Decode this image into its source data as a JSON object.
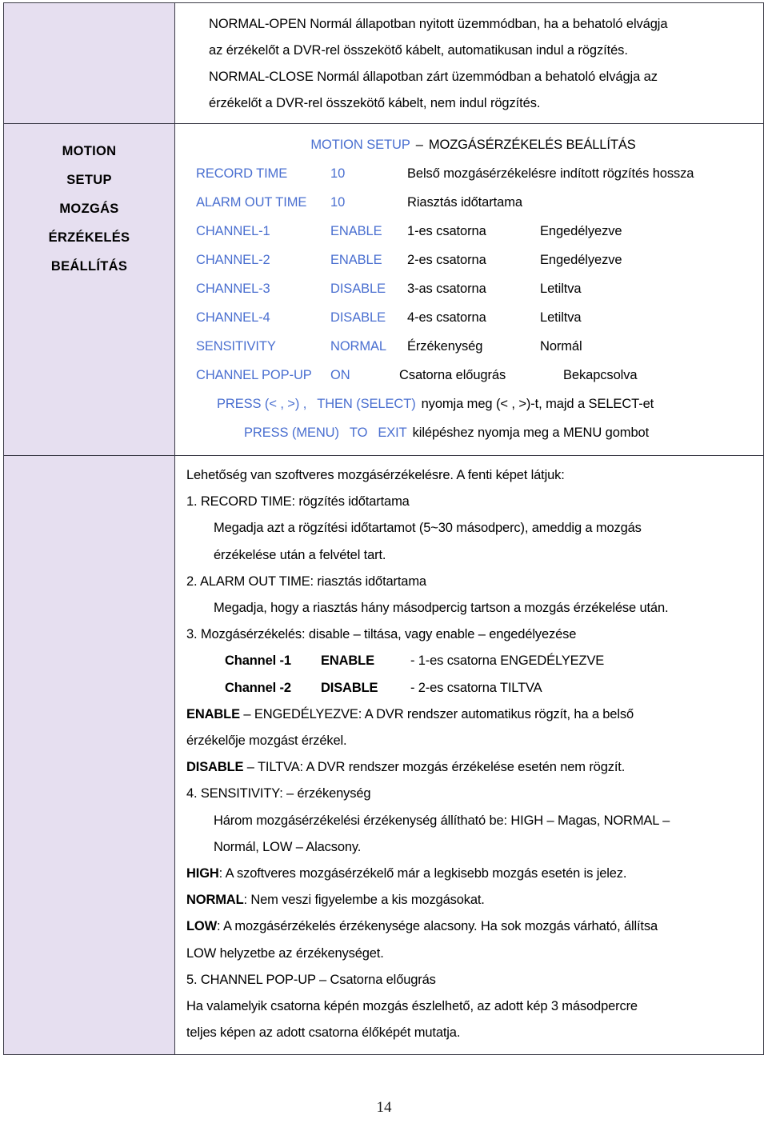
{
  "document": {
    "page_number": "14",
    "colors": {
      "sidebar_background": "#e6dff0",
      "menu_blue": "#4a6fd0",
      "border": "#3a3a46",
      "text": "#000000"
    }
  },
  "intro": {
    "line1": "NORMAL-OPEN Normál állapotban nyitott üzemmódban, ha a behatoló elvágja",
    "line2": "az érzékelőt a DVR-rel összekötő kábelt, automatikusan indul a rögzítés.",
    "line3": "NORMAL-CLOSE Normál állapotban zárt üzemmódban a behatoló elvágja az",
    "line4": "érzékelőt a DVR-rel összekötő kábelt, nem indul rögzítés."
  },
  "sidebar": {
    "items": [
      {
        "label": "MOTION"
      },
      {
        "label": "SETUP"
      },
      {
        "label": "MOZGÁS"
      },
      {
        "label": "ÉRZÉKELÉS"
      },
      {
        "label": "BEÁLLÍTÁS"
      }
    ]
  },
  "menu_screen": {
    "title_en": "MOTION SETUP",
    "title_sep": "–",
    "title_hu": "MOZGÁSÉRZÉKELÉS BEÁLLÍTÁS",
    "rows": [
      {
        "key": "RECORD TIME",
        "value": "10",
        "desc": "Belső mozgásérzékelésre indított rögzítés hossza",
        "state": ""
      },
      {
        "key": "ALARM OUT TIME",
        "value": "10",
        "desc": "Riasztás időtartama",
        "state": ""
      },
      {
        "key": "CHANNEL-1",
        "value": "ENABLE",
        "desc": "1-es csatorna",
        "state": "Engedélyezve"
      },
      {
        "key": "CHANNEL-2",
        "value": "ENABLE",
        "desc": "2-es csatorna",
        "state": "Engedélyezve"
      },
      {
        "key": "CHANNEL-3",
        "value": "DISABLE",
        "desc": "3-as csatorna",
        "state": "Letiltva"
      },
      {
        "key": "CHANNEL-4",
        "value": "DISABLE",
        "desc": "4-es csatorna",
        "state": "Letiltva"
      },
      {
        "key": "SENSITIVITY",
        "value": "NORMAL",
        "desc": "Érzékenység",
        "state": "Normál"
      },
      {
        "key": "CHANNEL POP-UP",
        "value": "ON",
        "desc": "Csatorna előugrás",
        "state": "Bekapcsolva"
      }
    ],
    "footer": {
      "press_keys_en_a": "PRESS (< , >) ,",
      "press_keys_en_b": "THEN (SELECT)",
      "press_keys_hu": "nyomja meg (< , >)-t, majd a SELECT-et",
      "press_menu_en_a": "PRESS (MENU)",
      "press_menu_en_b": "TO",
      "press_menu_en_c": "EXIT",
      "press_menu_hu": "kilépéshez nyomja meg a MENU gombot"
    }
  },
  "prose": {
    "intro_line": "Lehetőség van szoftveres mozgásérzékelésre. A fenti képet látjuk:",
    "item1_head": "1. RECORD TIME: rögzítés időtartama",
    "item1_body_a": "Megadja azt a rögzítési időtartamot (5~30 másodperc), ameddig a mozgás",
    "item1_body_b": "érzékelése után a felvétel tart.",
    "item2_head": "2. ALARM OUT TIME: riasztás időtartama",
    "item2_body": "Megadja, hogy a riasztás hány másodpercig tartson a mozgás érzékelése után.",
    "item3_head": "3. Mozgásérzékelés: disable – tiltása, vagy enable – engedélyezése",
    "channel1_name": "Channel -1",
    "channel1_val": "ENABLE",
    "channel1_desc": "- 1-es csatorna ENGEDÉLYEZVE",
    "channel2_name": "Channel -2",
    "channel2_val": "DISABLE",
    "channel2_desc": "- 2-es csatorna TILTVA",
    "enable_term": "ENABLE",
    "enable_text_a": " – ENGEDÉLYEZVE: A DVR rendszer automatikus rögzít, ha a belső",
    "enable_text_b": "érzékelője mozgást érzékel.",
    "disable_term": "DISABLE",
    "disable_text": " – TILTVA: A DVR rendszer mozgás érzékelése esetén nem rögzít.",
    "item4_head": "4. SENSITIVITY: – érzékenység",
    "item4_body_a": "Három mozgásérzékelési érzékenység állítható be: HIGH – Magas, NORMAL –",
    "item4_body_b": "Normál, LOW – Alacsony.",
    "high_term": "HIGH",
    "high_text": ": A szoftveres mozgásérzékelő már a legkisebb mozgás esetén is jelez.",
    "normal_term": "NORMAL",
    "normal_text": ": Nem veszi figyelembe a kis mozgásokat.",
    "low_term": "LOW",
    "low_text_a": ": A mozgásérzékelés érzékenysége alacsony. Ha sok mozgás várható, állítsa",
    "low_text_b": "LOW helyzetbe az érzékenységet.",
    "item5_head": "5. CHANNEL POP-UP – Csatorna előugrás",
    "item5_body_a": "Ha valamelyik csatorna képén mozgás észlelhető, az adott kép 3 másodpercre",
    "item5_body_b": "teljes képen az adott csatorna élőképét mutatja."
  }
}
